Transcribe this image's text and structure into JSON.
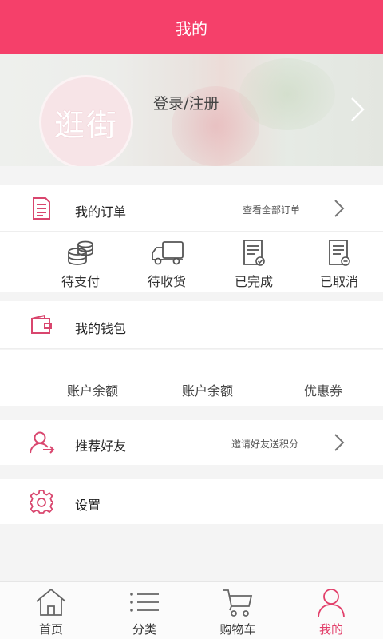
{
  "header": {
    "title": "我的"
  },
  "profile": {
    "avatar_text": "逛街",
    "login_label": "登录/注册"
  },
  "orders": {
    "label": "我的订单",
    "view_all": "查看全部订单",
    "statuses": [
      {
        "label": "待支付",
        "icon": "coins-icon"
      },
      {
        "label": "待收货",
        "icon": "truck-icon"
      },
      {
        "label": "已完成",
        "icon": "order-complete-icon"
      },
      {
        "label": "已取消",
        "icon": "order-cancel-icon"
      }
    ]
  },
  "wallet": {
    "label": "我的钱包",
    "items": [
      "账户余额",
      "账户余额",
      "优惠券"
    ]
  },
  "friends": {
    "label": "推荐好友",
    "hint": "邀请好友送积分"
  },
  "settings": {
    "label": "设置"
  },
  "tabbar": {
    "items": [
      {
        "label": "首页",
        "icon": "home-icon"
      },
      {
        "label": "分类",
        "icon": "list-icon"
      },
      {
        "label": "购物车",
        "icon": "cart-icon"
      },
      {
        "label": "我的",
        "icon": "user-icon"
      }
    ],
    "active_index": 3
  },
  "colors": {
    "brand": "#f5406a",
    "accent_icon": "#d9466e",
    "active_tab": "#e23f6a"
  }
}
